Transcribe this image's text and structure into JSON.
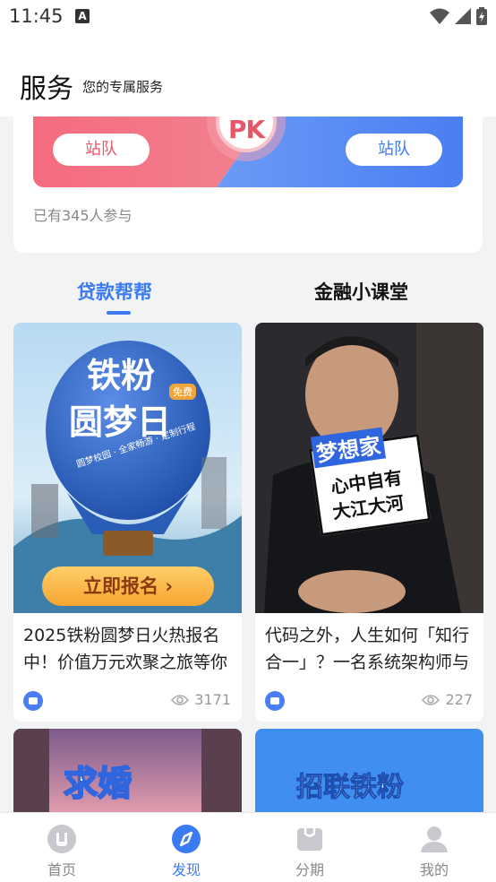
{
  "status_bar": {
    "time": "11:45"
  },
  "header": {
    "title": "服务",
    "subtitle": "您的专属服务"
  },
  "pk": {
    "left_button": "站队",
    "right_button": "站队",
    "badge": "PK",
    "participants": "已有345人参与"
  },
  "tabs": [
    {
      "label": "贷款帮帮",
      "active": true
    },
    {
      "label": "金融小课堂",
      "active": false
    }
  ],
  "cards": [
    {
      "caption": "2025铁粉圆梦日火热报名中！价值万元欢聚之旅等你",
      "views": "3171",
      "image": {
        "title_line1": "铁粉",
        "title_line2": "圆梦日",
        "badge": "免费",
        "tagline": "圆梦校园 · 全家畅游 · 定制行程",
        "cta": "立即报名 ›"
      }
    },
    {
      "caption": "代码之外，人生如何「知行合一」？一名系统架构师与",
      "views": "227",
      "image": {
        "sign_line1": "梦想家",
        "sign_line2": "心中自有",
        "sign_line3": "大江大河"
      }
    },
    {
      "image": {
        "text": "求婚"
      }
    },
    {
      "image": {
        "text": "招联铁粉"
      }
    }
  ],
  "bottom_nav": [
    {
      "label": "首页",
      "icon": "home-icon",
      "active": false
    },
    {
      "label": "发现",
      "icon": "discover-icon",
      "active": true
    },
    {
      "label": "分期",
      "icon": "installment-icon",
      "active": false
    },
    {
      "label": "我的",
      "icon": "profile-icon",
      "active": false
    }
  ],
  "colors": {
    "accent": "#3a7bf3",
    "pk_red": "#f0667b",
    "pk_blue": "#4a7ef2"
  }
}
